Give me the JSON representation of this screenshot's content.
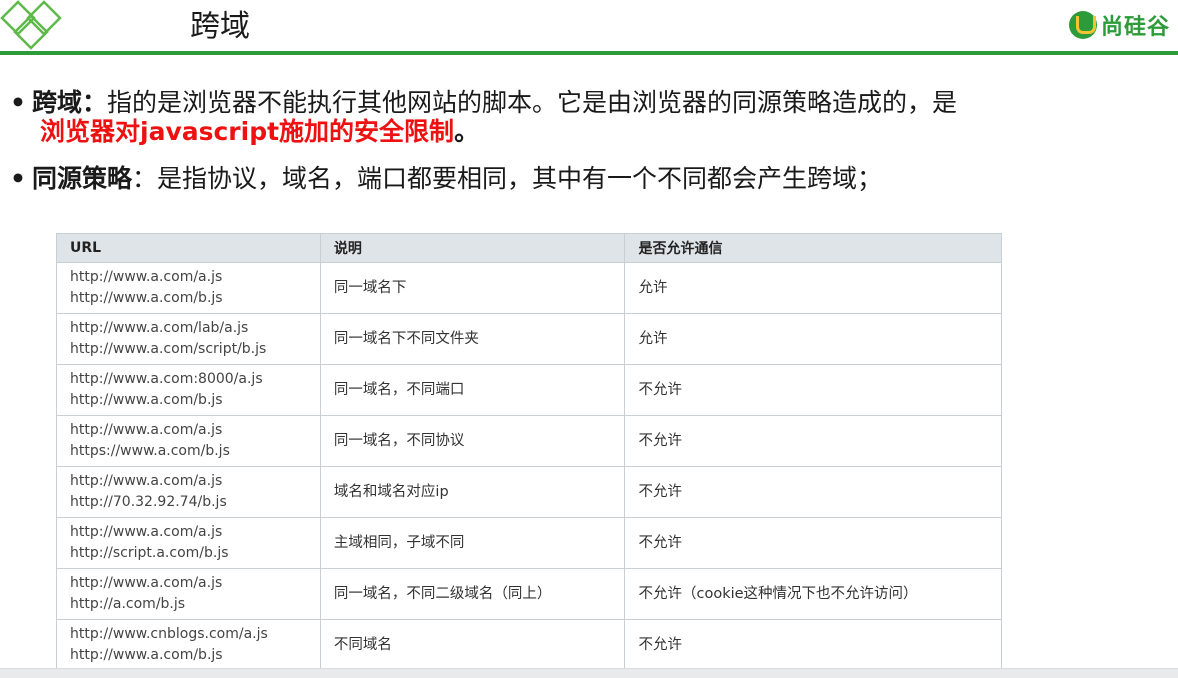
{
  "header": {
    "title": "跨域",
    "brand": "尚硅谷",
    "colors": {
      "brand_green": "#2e9b3a",
      "logo_green": "#5fb84a",
      "emphasis_red": "#ee1111"
    }
  },
  "bullets": [
    {
      "term": "跨域",
      "sep": "：",
      "text": "指的是浏览器不能执行其他网站的脚本。它是由浏览器的同源策略造成的，是",
      "emphasis": "浏览器对javascript施加的安全限制",
      "tail": "。"
    },
    {
      "term": "同源策略",
      "sep": "：",
      "text": "是指协议，域名，端口都要相同，其中有一个不同都会产生跨域；"
    }
  ],
  "table": {
    "headers": [
      "URL",
      "说明",
      "是否允许通信"
    ],
    "rows": [
      {
        "url1": "http://www.a.com/a.js",
        "url2": "http://www.a.com/b.js",
        "desc": "同一域名下",
        "allow": "允许"
      },
      {
        "url1": "http://www.a.com/lab/a.js",
        "url2": "http://www.a.com/script/b.js",
        "desc": "同一域名下不同文件夹",
        "allow": "允许"
      },
      {
        "url1": "http://www.a.com:8000/a.js",
        "url2": "http://www.a.com/b.js",
        "desc": "同一域名，不同端口",
        "allow": "不允许"
      },
      {
        "url1": "http://www.a.com/a.js",
        "url2": "https://www.a.com/b.js",
        "desc": "同一域名，不同协议",
        "allow": "不允许"
      },
      {
        "url1": "http://www.a.com/a.js",
        "url2": "http://70.32.92.74/b.js",
        "desc": "域名和域名对应ip",
        "allow": "不允许"
      },
      {
        "url1": "http://www.a.com/a.js",
        "url2": "http://script.a.com/b.js",
        "desc": "主域相同，子域不同",
        "allow": "不允许"
      },
      {
        "url1": "http://www.a.com/a.js",
        "url2": "http://a.com/b.js",
        "desc": "同一域名，不同二级域名（同上）",
        "allow": "不允许（cookie这种情况下也不允许访问）"
      },
      {
        "url1": "http://www.cnblogs.com/a.js",
        "url2": "http://www.a.com/b.js",
        "desc": "不同域名",
        "allow": "不允许"
      }
    ]
  },
  "icons": {
    "logo": "diamond-logo-icon",
    "brand": "brand-u-icon"
  }
}
